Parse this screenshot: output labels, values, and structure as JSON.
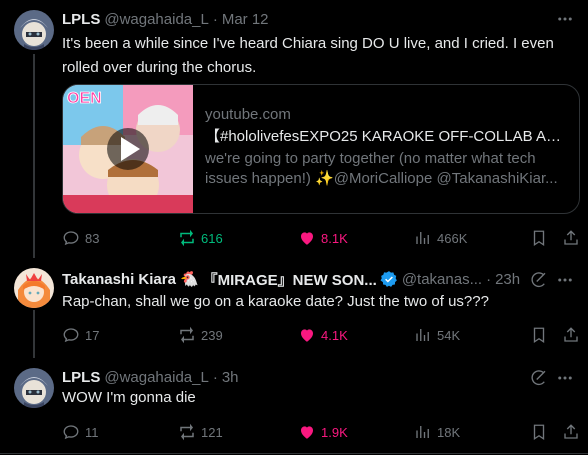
{
  "tweets": [
    {
      "name": "LPLS",
      "handle": "@wagahaida_L",
      "time": "Mar 12",
      "text": "It's been a while since I've heard Chiara sing DO U live, and I cried. I even rolled over during the chorus.",
      "card": {
        "domain": "youtube.com",
        "title": "【#hololivefesEXPO25 KARAOKE OFF-COLLAB AF...",
        "description": "we're going to party together (no matter what tech issues happen!) ✨@MoriCalliope @TakanashiKiar..."
      },
      "stats": {
        "replies": "83",
        "reposts": "616",
        "likes": "8.1K",
        "views": "466K"
      }
    },
    {
      "name": "Takanashi Kiara",
      "badge_emoji": "🐔",
      "name_suffix": "『MIRAGE』NEW SON...",
      "handle": "@takanas...",
      "time": "23h",
      "text": "Rap-chan, shall we go on a karaoke date? Just the two of us???",
      "stats": {
        "replies": "17",
        "reposts": "239",
        "likes": "4.1K",
        "views": "54K"
      }
    },
    {
      "name": "LPLS",
      "handle": "@wagahaida_L",
      "time": "3h",
      "text": "WOW I'm gonna die",
      "stats": {
        "replies": "11",
        "reposts": "121",
        "likes": "1.9K",
        "views": "18K"
      }
    }
  ],
  "colors": {
    "background": "#000000",
    "muted": "#71767b",
    "repost_active": "#00ba7c",
    "like_active": "#f91880",
    "verified": "#1d9bf0"
  }
}
